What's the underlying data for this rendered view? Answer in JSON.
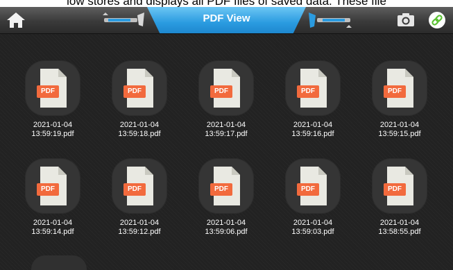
{
  "caption": "low stores and displays all PDF files of saved data. These file",
  "header": {
    "title": "PDF View",
    "home_icon": "home-icon",
    "camera_icon": "camera-icon",
    "link_icon": "link-icon",
    "accent": "#2a9be0"
  },
  "file_badge": "PDF",
  "files": [
    {
      "date": "2021-01-04",
      "name": "13:59:19.pdf"
    },
    {
      "date": "2021-01-04",
      "name": "13:59:18.pdf"
    },
    {
      "date": "2021-01-04",
      "name": "13:59:17.pdf"
    },
    {
      "date": "2021-01-04",
      "name": "13:59:16.pdf"
    },
    {
      "date": "2021-01-04",
      "name": "13:59:15.pdf"
    },
    {
      "date": "2021-01-04",
      "name": "13:59:14.pdf"
    },
    {
      "date": "2021-01-04",
      "name": "13:59:12.pdf"
    },
    {
      "date": "2021-01-04",
      "name": "13:59:06.pdf"
    },
    {
      "date": "2021-01-04",
      "name": "13:59:03.pdf"
    },
    {
      "date": "2021-01-04",
      "name": "13:58:55.pdf"
    }
  ]
}
